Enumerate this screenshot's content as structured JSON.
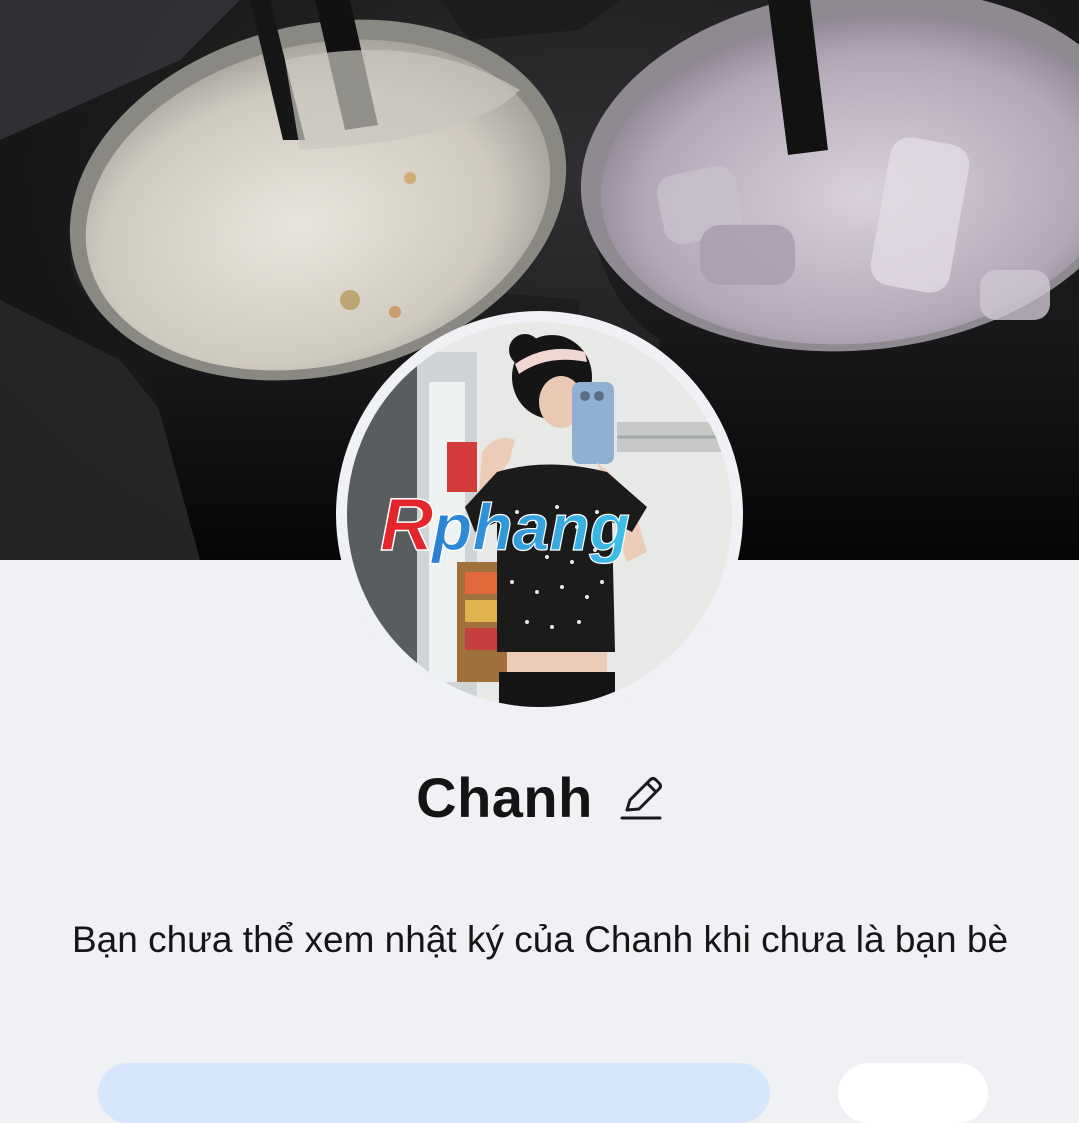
{
  "profile": {
    "name": "Chanh",
    "edit_icon": "pencil-edit-icon",
    "watermark": "Rphang",
    "diary_message": "Bạn chưa thể xem nhật ký của Chanh khi chưa là bạn bè"
  },
  "colors": {
    "background": "#eff1f5",
    "primary_button": "#d6e6fb",
    "secondary_button": "#ffffff",
    "watermark_red": "#e3262c",
    "watermark_blue": "#1f8fd6"
  }
}
